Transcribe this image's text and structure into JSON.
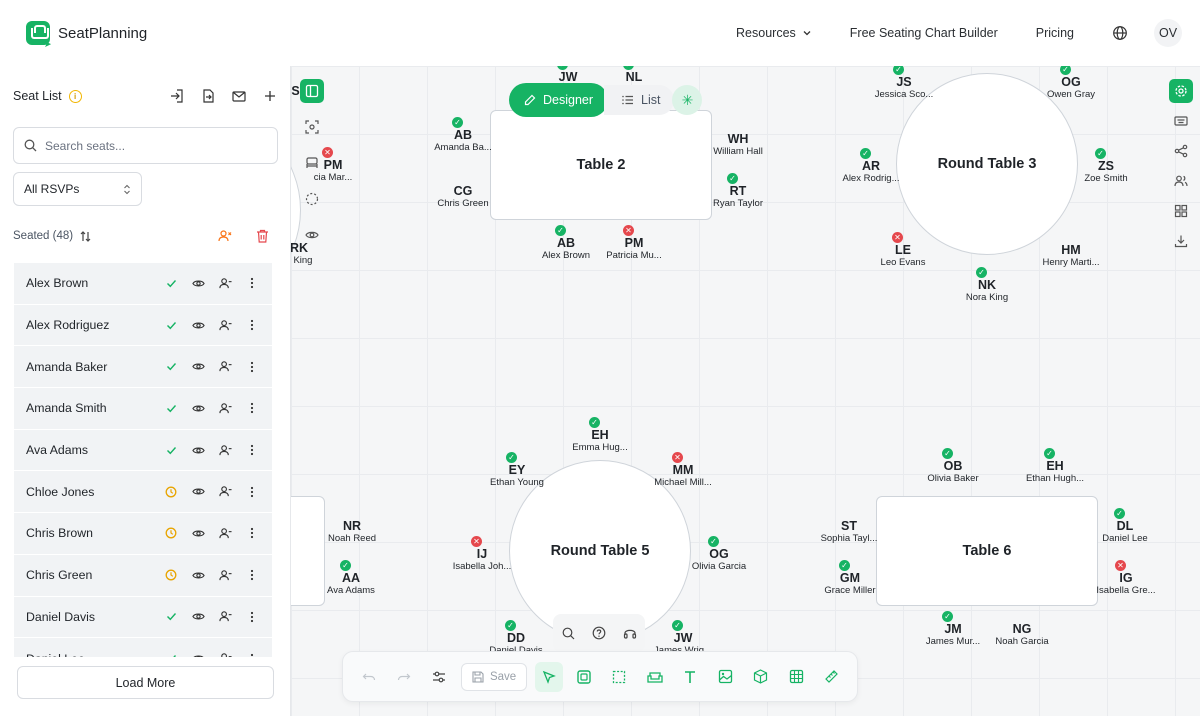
{
  "app": {
    "name": "SeatPlanning"
  },
  "nav": {
    "resources": "Resources",
    "builder": "Free Seating Chart Builder",
    "pricing": "Pricing",
    "avatar": "OV"
  },
  "sidebar": {
    "title": "Seat List",
    "search_placeholder": "Search seats...",
    "rsvp_filter": "All RSVPs",
    "seated_label": "Seated (48)",
    "load_more": "Load More",
    "guests": [
      {
        "name": "Alex Brown",
        "status": "confirmed"
      },
      {
        "name": "Alex Rodriguez",
        "status": "confirmed"
      },
      {
        "name": "Amanda Baker",
        "status": "confirmed"
      },
      {
        "name": "Amanda Smith",
        "status": "confirmed"
      },
      {
        "name": "Ava Adams",
        "status": "confirmed"
      },
      {
        "name": "Chloe Jones",
        "status": "pending"
      },
      {
        "name": "Chris Brown",
        "status": "pending"
      },
      {
        "name": "Chris Green",
        "status": "pending"
      },
      {
        "name": "Daniel Davis",
        "status": "confirmed"
      },
      {
        "name": "Daniel Lee",
        "status": "confirmed"
      }
    ]
  },
  "mode": {
    "designer": "Designer",
    "list": "List"
  },
  "toolbar": {
    "save": "Save"
  },
  "tables": {
    "t2": "Table 2",
    "rt3": "Round Table 3",
    "rt5": "Round Table 5",
    "t6": "Table 6"
  },
  "seats": [
    {
      "i": "AS",
      "n": "",
      "s": ""
    },
    {
      "i": "PM",
      "n": "cia Mar...",
      "s": "no"
    },
    {
      "i": "RK",
      "n": "n King",
      "s": ""
    },
    {
      "i": "JW",
      "n": "",
      "s": "ok"
    },
    {
      "i": "NL",
      "n": "",
      "s": "ok"
    },
    {
      "i": "AB",
      "n": "Amanda Ba...",
      "s": "ok"
    },
    {
      "i": "CG",
      "n": "Chris Green",
      "s": ""
    },
    {
      "i": "WH",
      "n": "William Hall",
      "s": ""
    },
    {
      "i": "RT",
      "n": "Ryan Taylor",
      "s": "ok"
    },
    {
      "i": "AB",
      "n": "Alex Brown",
      "s": "ok"
    },
    {
      "i": "PM",
      "n": "Patricia Mu...",
      "s": "no"
    },
    {
      "i": "JS",
      "n": "Jessica Sco...",
      "s": "ok"
    },
    {
      "i": "OG",
      "n": "Owen Gray",
      "s": "ok"
    },
    {
      "i": "AR",
      "n": "Alex Rodrig...",
      "s": "ok"
    },
    {
      "i": "ZS",
      "n": "Zoe Smith",
      "s": "ok"
    },
    {
      "i": "LE",
      "n": "Leo Evans",
      "s": "no"
    },
    {
      "i": "HM",
      "n": "Henry Marti...",
      "s": ""
    },
    {
      "i": "NK",
      "n": "Nora King",
      "s": "ok"
    },
    {
      "i": "EH",
      "n": "Emma Hug...",
      "s": "ok"
    },
    {
      "i": "EY",
      "n": "Ethan Young",
      "s": "ok"
    },
    {
      "i": "MM",
      "n": "Michael Mill...",
      "s": "no"
    },
    {
      "i": "IJ",
      "n": "Isabella Joh...",
      "s": "no"
    },
    {
      "i": "OG",
      "n": "Olivia Garcia",
      "s": "ok"
    },
    {
      "i": "DD",
      "n": "Daniel Davis",
      "s": "ok"
    },
    {
      "i": "JW",
      "n": "James Wrig...",
      "s": "ok"
    },
    {
      "i": "NR",
      "n": "Noah Reed",
      "s": ""
    },
    {
      "i": "AA",
      "n": "Ava Adams",
      "s": "ok"
    },
    {
      "i": "OB",
      "n": "Olivia Baker",
      "s": "ok"
    },
    {
      "i": "EH",
      "n": "Ethan Hugh...",
      "s": "ok"
    },
    {
      "i": "ST",
      "n": "Sophia Tayl...",
      "s": ""
    },
    {
      "i": "GM",
      "n": "Grace Miller",
      "s": "ok"
    },
    {
      "i": "DL",
      "n": "Daniel Lee",
      "s": "ok"
    },
    {
      "i": "IG",
      "n": "Isabella Gre...",
      "s": "no"
    },
    {
      "i": "JM",
      "n": "James Mur...",
      "s": "ok"
    },
    {
      "i": "NG",
      "n": "Noah Garcia",
      "s": ""
    }
  ],
  "colors": {
    "accent": "#16b364",
    "declined": "#e5484d",
    "pending": "#f2b705"
  }
}
